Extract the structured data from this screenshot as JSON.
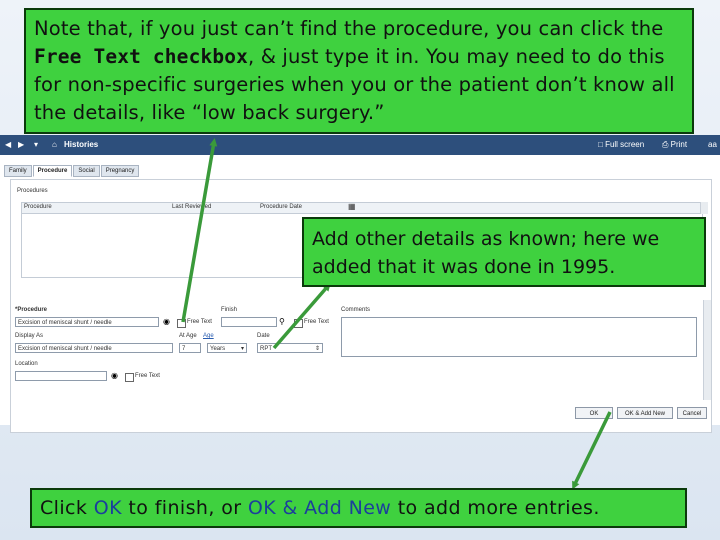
{
  "window": {
    "title": "Histories",
    "full_screen_label": "Full screen",
    "print_label": "Print",
    "right_label": "aa"
  },
  "tabs": [
    {
      "label": "Family"
    },
    {
      "label": "Procedure"
    },
    {
      "label": "Social"
    },
    {
      "label": "Pregnancy"
    }
  ],
  "procedures": {
    "section_label": "Procedures",
    "columns": [
      "Procedure",
      "Last Reviewed",
      "Procedure Date"
    ]
  },
  "form": {
    "procedure_label": "*Procedure",
    "procedure_value": "Excision of meniscal shunt / needle",
    "free_text_label": "Free Text",
    "finish_label": "Finish",
    "free_text_label_2": "Free Text",
    "comments_label": "Comments",
    "display_as_label": "Display As",
    "display_as_value": "Excision of meniscal shunt / needle",
    "at_age_label": "At Age",
    "age_link": "Age",
    "age_value": "7",
    "age_unit": "Years",
    "date_label": "Date",
    "date_value": "RPT",
    "location_label": "Location",
    "location_free_text": "Free Text"
  },
  "buttons": {
    "ok": "OK",
    "ok_add_new": "OK & Add New",
    "cancel": "Cancel"
  },
  "callouts": {
    "top_part1": "Note that, if you just can’t find the procedure, you can click the ",
    "top_bold": "Free Text checkbox",
    "top_part2": ", & just type it in.  You may need to do this for non-specific surgeries when you or the patient don’t know all the details, like “low back surgery.”",
    "middle": "Add other details as known; here we added that it was done in 1995.",
    "bottom_part1": "Click ",
    "bottom_ok": "OK",
    "bottom_part2": " to finish, or ",
    "bottom_ok_add": "OK & Add New",
    "bottom_part3": " to add more entries."
  },
  "colors": {
    "callout_bg": "#3fd13f",
    "arrow": "#3a9a3a",
    "titlebar": "#2d4f7c",
    "highlight_text": "#1b3f9c"
  }
}
